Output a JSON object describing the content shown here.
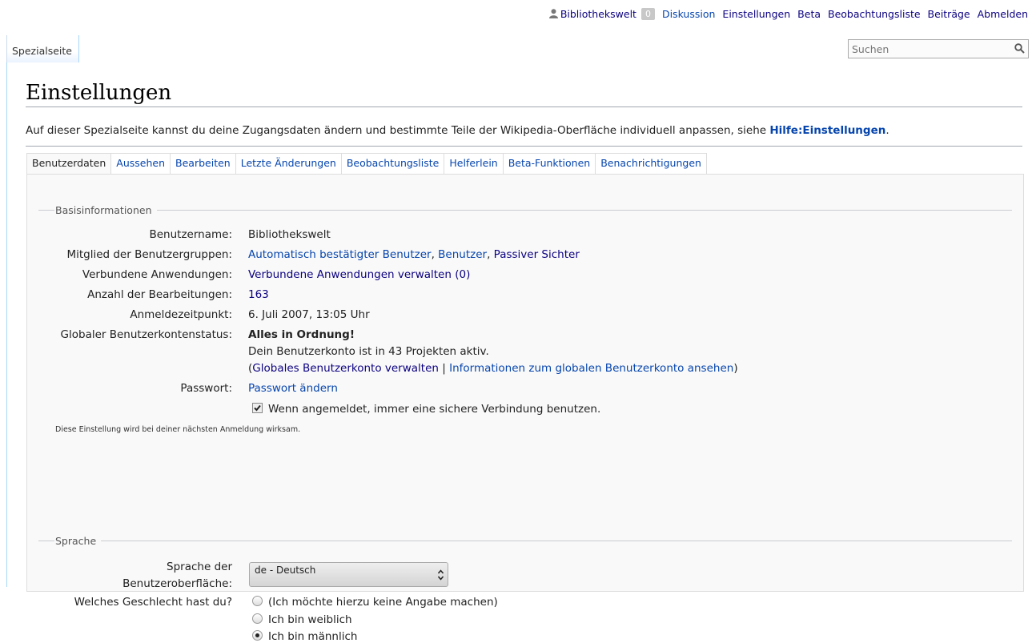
{
  "personal": {
    "user": "Bibliothekswelt",
    "notifications": "0",
    "links": [
      "Diskussion",
      "Einstellungen",
      "Beta",
      "Beobachtungsliste",
      "Beiträge",
      "Abmelden"
    ]
  },
  "nav": {
    "tab": "Spezialseite"
  },
  "search": {
    "placeholder": "Suchen"
  },
  "page": {
    "title": "Einstellungen",
    "intro_text": "Auf dieser Spezialseite kannst du deine Zugangsdaten ändern und bestimmte Teile der Wikipedia-Oberfläche individuell anpassen, siehe ",
    "intro_link": "Hilfe:Einstellungen",
    "intro_end": "."
  },
  "pref_tabs": [
    "Benutzerdaten",
    "Aussehen",
    "Bearbeiten",
    "Letzte Änderungen",
    "Beobachtungsliste",
    "Helferlein",
    "Beta-Funktionen",
    "Benachrichtigungen"
  ],
  "basis": {
    "legend": "Basisinformationen",
    "username_label": "Benutzername:",
    "username": "Bibliothekswelt",
    "groups_label": "Mitglied der Benutzergruppen:",
    "group1": "Automatisch bestätigter Benutzer",
    "group2": "Benutzer",
    "group3": "Passiver Sichter",
    "apps_label": "Verbundene Anwendungen:",
    "apps_link": "Verbundene Anwendungen verwalten (0)",
    "edits_label": "Anzahl der Bearbeitungen:",
    "edits": "163",
    "reg_label": "Anmeldezeitpunkt:",
    "reg": "6. Juli 2007, 13:05 Uhr",
    "global_label": "Globaler Benutzerkontenstatus:",
    "global_status": "Alles in Ordnung!",
    "global_text": "Dein Benutzerkonto ist in 43 Projekten aktiv.",
    "global_manage": "Globales Benutzerkonto verwalten",
    "global_info": "Informationen zum globalen Benutzerkonto ansehen",
    "password_label": "Passwort:",
    "password_link": "Passwort ändern",
    "secure_label": "Wenn angemeldet, immer eine sichere Verbindung benutzen.",
    "secure_checked": true,
    "note": "Diese Einstellung wird bei deiner nächsten Anmeldung wirksam."
  },
  "lang": {
    "legend": "Sprache",
    "ui_label_1": "Sprache der",
    "ui_label_2": "Benutzeroberfläche:",
    "ui_value": "de - Deutsch",
    "gender_label": "Welches Geschlecht hast du?",
    "gender_options": [
      "(Ich möchte hierzu keine Angabe machen)",
      "Ich bin weiblich",
      "Ich bin männlich"
    ],
    "gender_selected": "Ich bin männlich"
  }
}
